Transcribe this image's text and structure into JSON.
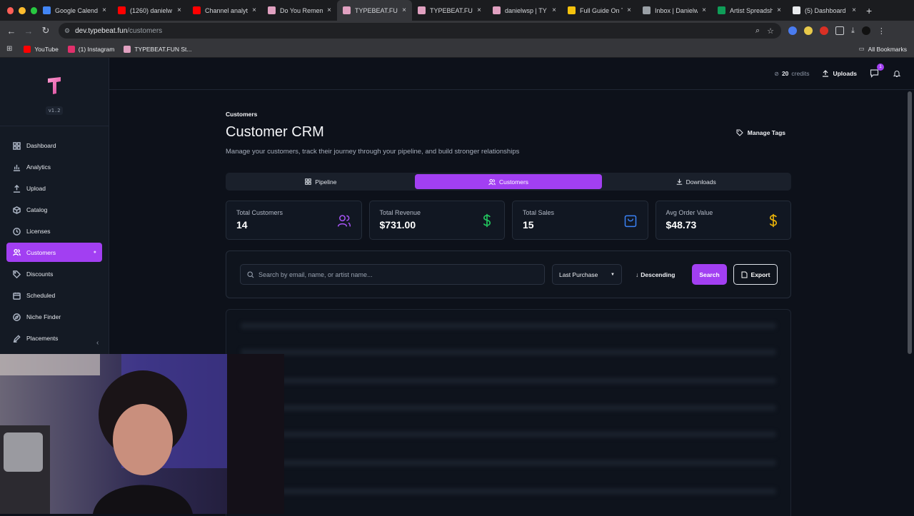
{
  "browser": {
    "tabs": [
      {
        "title": "Google Calenda",
        "color": "#4285f4",
        "active": false
      },
      {
        "title": "(1260) danielw",
        "color": "#ff0000",
        "active": false
      },
      {
        "title": "Channel analyti",
        "color": "#ff0000",
        "active": false
      },
      {
        "title": "Do You Remem",
        "color": "#e0a0c0",
        "active": false
      },
      {
        "title": "TYPEBEAT.FU",
        "color": "#e0a0c0",
        "active": true
      },
      {
        "title": "TYPEBEAT.FUN",
        "color": "#e0a0c0",
        "active": false
      },
      {
        "title": "danielwsp | TY",
        "color": "#e0a0c0",
        "active": false
      },
      {
        "title": "Full Guide On T",
        "color": "#f4c20d",
        "active": false
      },
      {
        "title": "Inbox | Danielw",
        "color": "#9aa0a6",
        "active": false
      },
      {
        "title": "Artist Spreadsh",
        "color": "#0f9d58",
        "active": false
      },
      {
        "title": "(5) Dashboard",
        "color": "#e8eaed",
        "active": false
      }
    ],
    "url_host": "dev.typebeat.fun",
    "url_path": "/customers",
    "bookmarks": [
      {
        "label": "YouTube",
        "color": "#ff0000"
      },
      {
        "label": "(1) Instagram",
        "color": "#e1306c"
      },
      {
        "label": "TYPEBEAT.FUN St...",
        "color": "#e0a0c0"
      }
    ],
    "all_bookmarks": "All Bookmarks"
  },
  "sidebar": {
    "version": "v1.2",
    "items": [
      {
        "label": "Dashboard",
        "icon": "dashboard-icon",
        "active": false
      },
      {
        "label": "Analytics",
        "icon": "analytics-icon",
        "active": false
      },
      {
        "label": "Upload",
        "icon": "upload-icon",
        "active": false
      },
      {
        "label": "Catalog",
        "icon": "catalog-icon",
        "active": false
      },
      {
        "label": "Licenses",
        "icon": "license-icon",
        "active": false
      },
      {
        "label": "Customers",
        "icon": "users-icon",
        "active": true
      },
      {
        "label": "Discounts",
        "icon": "tag-icon",
        "active": false
      },
      {
        "label": "Scheduled",
        "icon": "calendar-icon",
        "active": false
      },
      {
        "label": "Niche Finder",
        "icon": "compass-icon",
        "active": false
      },
      {
        "label": "Placements",
        "icon": "pen-icon",
        "active": false
      }
    ]
  },
  "topbar": {
    "credits_value": "20",
    "credits_label": "credits",
    "uploads_label": "Uploads",
    "chat_badge": "1"
  },
  "main": {
    "breadcrumb": "Customers",
    "title": "Customer CRM",
    "subtitle": "Manage your customers, track their journey through your pipeline, and build stronger relationships",
    "manage_tags": "Manage Tags",
    "tabs": [
      {
        "label": "Pipeline",
        "active": false
      },
      {
        "label": "Customers",
        "active": true
      },
      {
        "label": "Downloads",
        "active": false
      }
    ],
    "stats": [
      {
        "label": "Total Customers",
        "value": "14",
        "icon": "users-icon",
        "color": "#a855f7"
      },
      {
        "label": "Total Revenue",
        "value": "$731.00",
        "icon": "dollar-icon",
        "color": "#22c55e"
      },
      {
        "label": "Total Sales",
        "value": "15",
        "icon": "shopping-bag-icon",
        "color": "#3b82f6"
      },
      {
        "label": "Avg Order Value",
        "value": "$48.73",
        "icon": "dollar-icon",
        "color": "#eab308"
      }
    ],
    "search_placeholder": "Search by email, name, or artist name...",
    "sort_value": "Last Purchase",
    "order_label": "Descending",
    "search_button": "Search",
    "export_button": "Export"
  },
  "colors": {
    "accent": "#a23ff2",
    "background": "#0d111a",
    "sidebar": "#141a24"
  }
}
